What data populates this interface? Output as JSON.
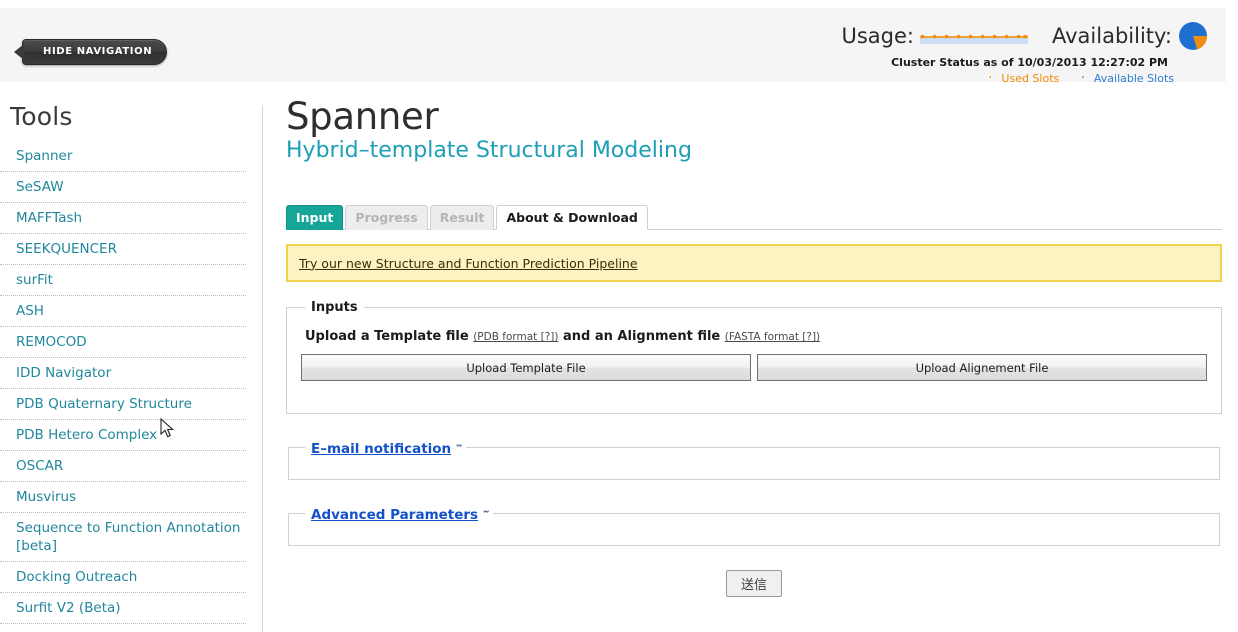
{
  "header": {
    "hide_nav_label": "HIDE NAVIGATION",
    "usage_label": "Usage:",
    "availability_label": "Availability:",
    "cluster_status_text": "Cluster Status as of 10/03/2013 12:27:02 PM",
    "legend_used": "Used Slots",
    "legend_available": "Available Slots",
    "colors": {
      "used": "#f08a00",
      "available": "#2f7fd4",
      "pie_blue": "#1f6fd0",
      "pie_orange": "#f58c12"
    }
  },
  "sidebar": {
    "heading": "Tools",
    "items": [
      {
        "label": "Spanner"
      },
      {
        "label": "SeSAW"
      },
      {
        "label": "MAFFTash"
      },
      {
        "label": "SEEKQUENCER"
      },
      {
        "label": "surFit"
      },
      {
        "label": "ASH"
      },
      {
        "label": "REMOCOD"
      },
      {
        "label": "IDD Navigator"
      },
      {
        "label": "PDB Quaternary Structure"
      },
      {
        "label": "PDB Hetero Complex"
      },
      {
        "label": "OSCAR"
      },
      {
        "label": "Musvirus"
      },
      {
        "label": "Sequence to Function Annotation [beta]"
      },
      {
        "label": "Docking Outreach"
      },
      {
        "label": "Surfit V2 (Beta)"
      }
    ]
  },
  "main": {
    "title": "Spanner",
    "subtitle": "Hybrid–template Structural Modeling",
    "tabs": [
      {
        "label": "Input",
        "state": "active"
      },
      {
        "label": "Progress",
        "state": "disabled"
      },
      {
        "label": "Result",
        "state": "disabled"
      },
      {
        "label": "About & Download",
        "state": "plain"
      }
    ],
    "notice": {
      "link_text": "Try our new Structure and Function Prediction Pipeline"
    },
    "inputs_panel": {
      "legend": "Inputs",
      "desc_part1": "Upload a Template file",
      "pdb_format_link": "(PDB format [?])",
      "desc_part2": "and an Alignment file",
      "fasta_format_link": "(FASTA format [?])",
      "upload_template_label": "Upload Template File",
      "upload_alignment_label": "Upload Alignement File"
    },
    "email_panel": {
      "legend": "E–mail notification",
      "chevron": "ˇˇ"
    },
    "advanced_panel": {
      "legend": "Advanced Parameters",
      "chevron": "ˇˇ"
    },
    "submit_label": "送信"
  },
  "chart_data": [
    {
      "type": "line",
      "title": "Usage",
      "x": [
        0,
        1,
        2,
        3,
        4,
        5,
        6,
        7,
        8,
        9
      ],
      "values": [
        0,
        0,
        0,
        0,
        0,
        0,
        0,
        0,
        0,
        0
      ],
      "series": [
        {
          "name": "Used Slots",
          "values": [
            0,
            0,
            0,
            0,
            0,
            0,
            0,
            0,
            0,
            0
          ]
        }
      ],
      "xlabel": "",
      "ylabel": "",
      "ylim": [
        0,
        1
      ],
      "grid": false,
      "legend_position": "below",
      "marker_color": "#f08a00",
      "area_color": "#ccddf5"
    },
    {
      "type": "pie",
      "title": "Availability",
      "categories": [
        "Available Slots",
        "Used Slots"
      ],
      "values": [
        75,
        25
      ],
      "colors": [
        "#1f6fd0",
        "#f58c12"
      ],
      "legend_position": "below"
    }
  ]
}
